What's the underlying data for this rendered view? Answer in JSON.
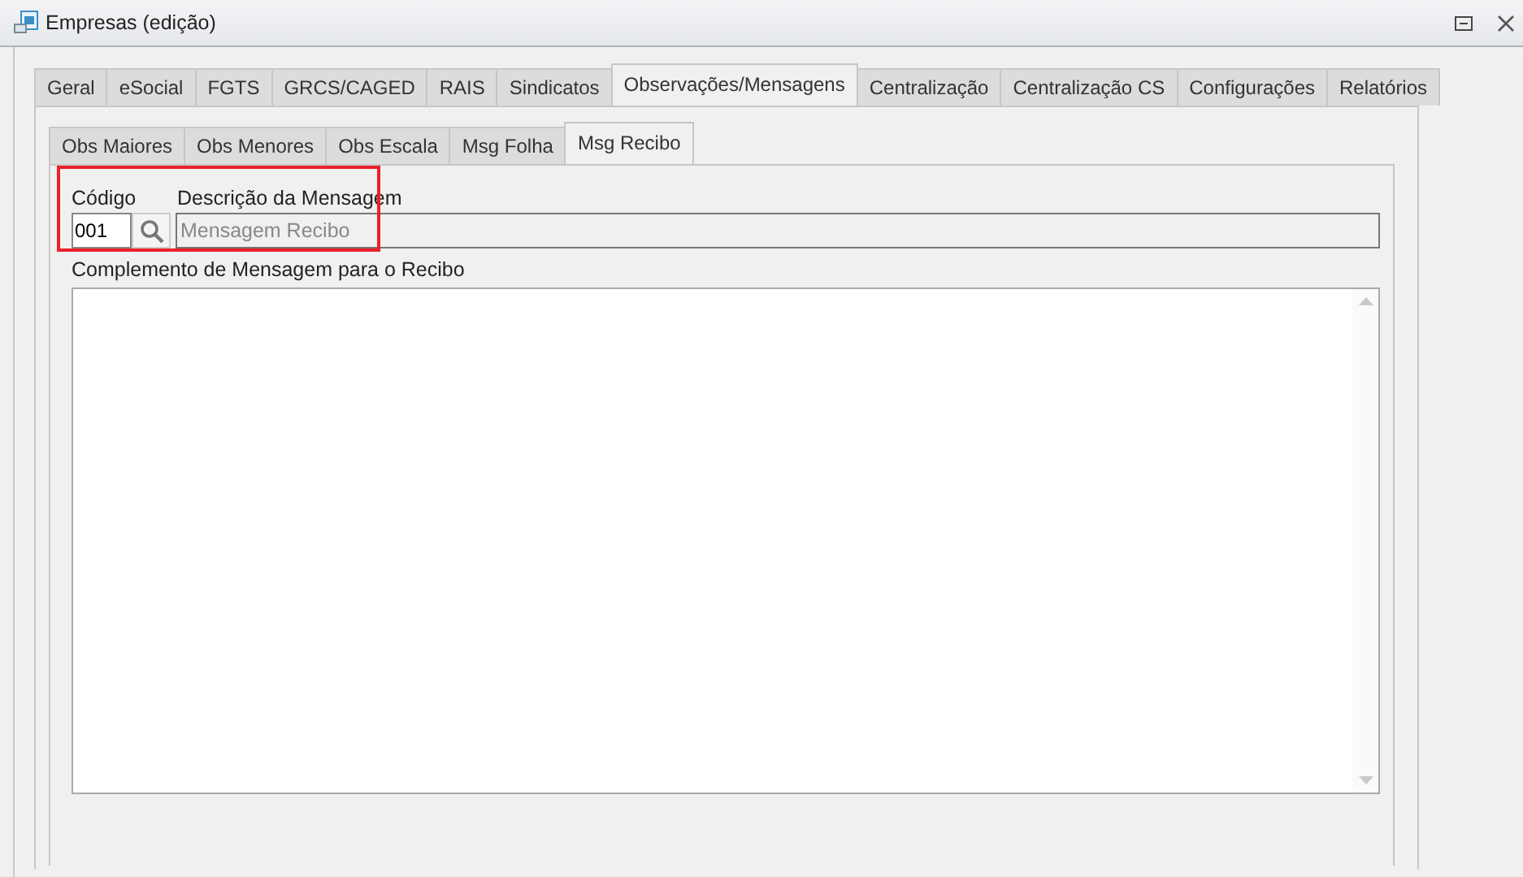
{
  "window": {
    "title": "Empresas (edição)"
  },
  "tabs": [
    {
      "label": "Geral",
      "selected": false
    },
    {
      "label": "eSocial",
      "selected": false
    },
    {
      "label": "FGTS",
      "selected": false
    },
    {
      "label": "GRCS/CAGED",
      "selected": false
    },
    {
      "label": "RAIS",
      "selected": false
    },
    {
      "label": "Sindicatos",
      "selected": false
    },
    {
      "label": "Observações/Mensagens",
      "selected": true
    },
    {
      "label": "Centralização",
      "selected": false
    },
    {
      "label": "Centralização CS",
      "selected": false
    },
    {
      "label": "Configurações",
      "selected": false
    },
    {
      "label": "Relatórios",
      "selected": false
    }
  ],
  "subtabs": [
    {
      "label": "Obs Maiores",
      "selected": false
    },
    {
      "label": "Obs Menores",
      "selected": false
    },
    {
      "label": "Obs Escala",
      "selected": false
    },
    {
      "label": "Msg Folha",
      "selected": false
    },
    {
      "label": "Msg Recibo",
      "selected": true
    }
  ],
  "form": {
    "code_label": "Código",
    "code_value": "001",
    "description_label": "Descrição da Mensagem",
    "description_value": "Mensagem Recibo",
    "complement_label": "Complemento de Mensagem para o Recibo"
  }
}
